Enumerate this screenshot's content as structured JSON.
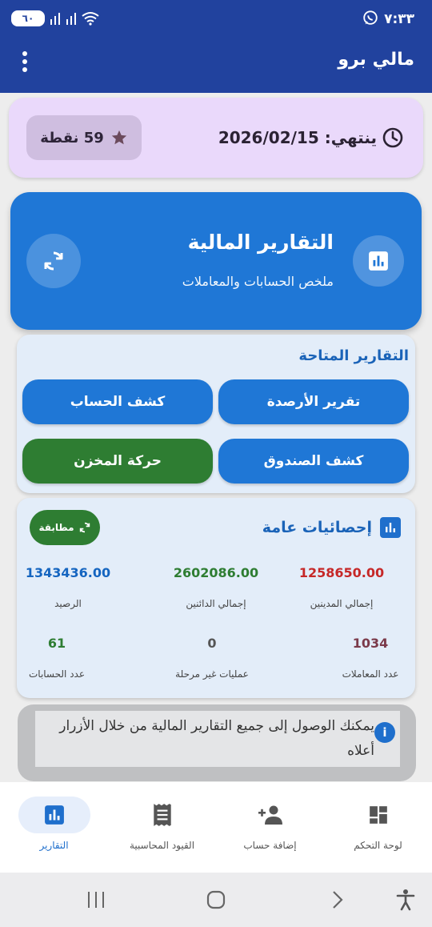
{
  "status_bar": {
    "time": "٧:٣٣",
    "battery": "٦٠"
  },
  "app_bar": {
    "title": "مالي برو",
    "menu_icon": "more-vert-icon"
  },
  "subscription": {
    "expiry_label": "ينتهي: 2026/02/15",
    "points_label": "59 نقطة",
    "clock_icon": "clock-icon",
    "star_icon": "star-icon"
  },
  "hero": {
    "title": "التقارير المالية",
    "subtitle": "ملخص الحسابات والمعاملات",
    "icon": "bar-chart-icon",
    "refresh_icon": "refresh-icon"
  },
  "reports": {
    "title": "التقارير المتاحة",
    "buttons": [
      {
        "label": "تقرير الأرصدة",
        "color": "#1f77d6"
      },
      {
        "label": "كشف الحساب",
        "color": "#1f77d6"
      },
      {
        "label": "كشف الصندوق",
        "color": "#1f77d6"
      },
      {
        "label": "حركة المخزن",
        "color": "#2e7d32"
      }
    ]
  },
  "stats": {
    "title": "إحصائيات عامة",
    "match_button": "مطابقة",
    "items": [
      {
        "value": "1258650.00",
        "label": "إجمالي المدينين",
        "color": "#c62828"
      },
      {
        "value": "2602086.00",
        "label": "إجمالي الدائنين",
        "color": "#2e7d32"
      },
      {
        "value": "1343436.00",
        "label": "الرصيد",
        "color": "#1565c0"
      },
      {
        "value": "1034",
        "label": "عدد المعاملات",
        "color": "#7b3a4a"
      },
      {
        "value": "0",
        "label": "عمليات غير مرحلة",
        "color": "#555555"
      },
      {
        "value": "61",
        "label": "عدد الحسابات",
        "color": "#2e7d32"
      }
    ]
  },
  "info": {
    "text": "يمكنك الوصول إلى جميع التقارير المالية من خلال الأزرار أعلاه",
    "icon": "info-icon"
  },
  "bottom_nav": {
    "items": [
      {
        "label": "لوحة التحكم",
        "icon": "dashboard-icon"
      },
      {
        "label": "إضافة حساب",
        "icon": "person-add-icon"
      },
      {
        "label": "القيود المحاسبية",
        "icon": "receipt-icon"
      },
      {
        "label": "التقارير",
        "icon": "bar-chart-icon",
        "active": true
      }
    ]
  },
  "colors": {
    "primary": "#21429e",
    "accent_blue": "#1f77d6",
    "accent_green": "#2e7d32"
  }
}
